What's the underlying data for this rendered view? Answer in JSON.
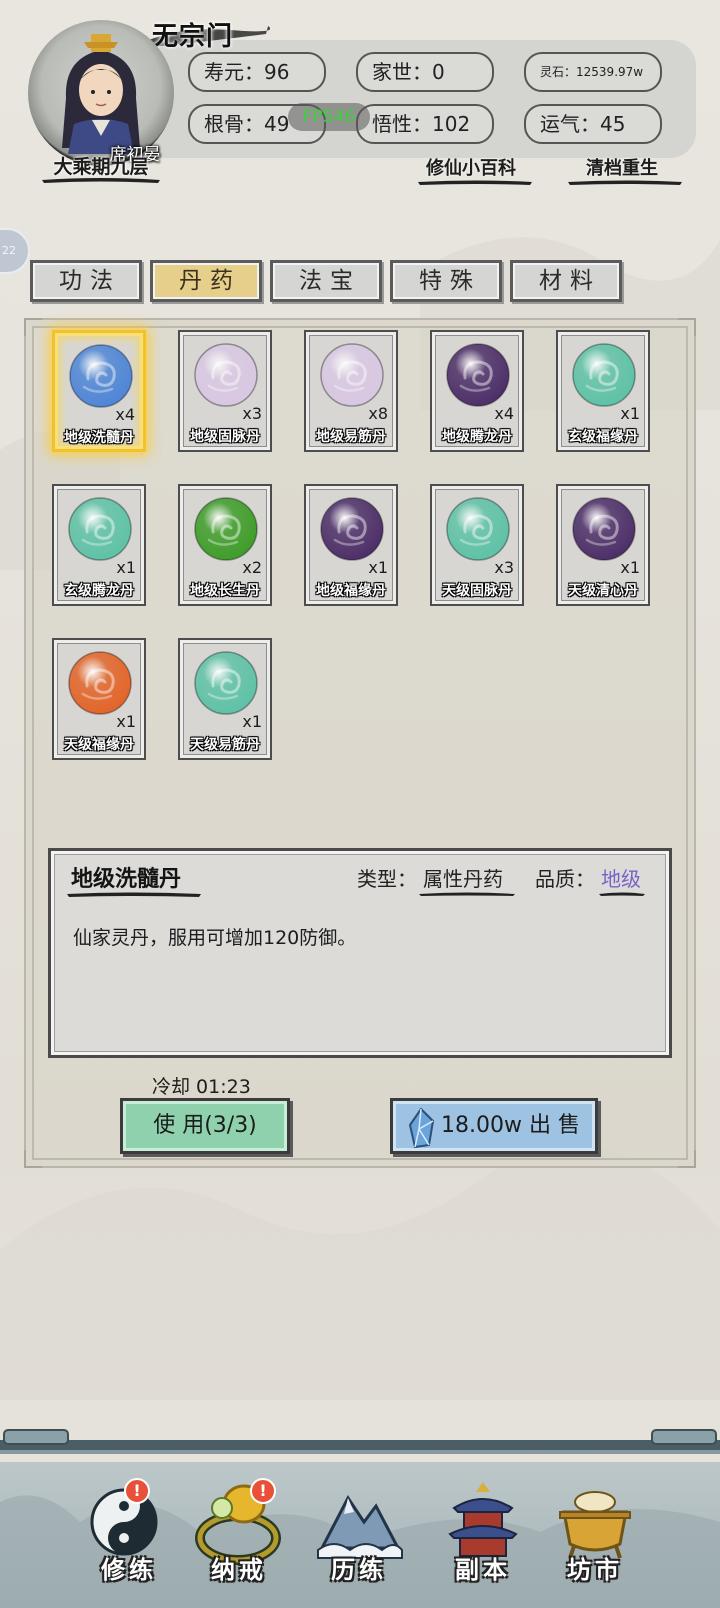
{
  "header": {
    "sect_name": "无宗门",
    "player_name": "席初晏",
    "realm": "大乘期九层",
    "fps": "FPS46",
    "stats": [
      {
        "label": "寿元：",
        "value": "96"
      },
      {
        "label": "家世：",
        "value": "0"
      },
      {
        "label": "灵石：",
        "value": "12539.97w"
      },
      {
        "label": "根骨：",
        "value": "49"
      },
      {
        "label": "悟性：",
        "value": "102"
      },
      {
        "label": "运气：",
        "value": "45"
      }
    ],
    "links": {
      "wiki": "修仙小百科",
      "reset": "清档重生"
    },
    "side_tab": "22"
  },
  "tabs": [
    {
      "label": "功法",
      "active": false
    },
    {
      "label": "丹药",
      "active": true
    },
    {
      "label": "法宝",
      "active": false
    },
    {
      "label": "特殊",
      "active": false
    },
    {
      "label": "材料",
      "active": false
    }
  ],
  "items": [
    {
      "name": "地级洗髓丹",
      "qty": "x4",
      "color": "#4f86d6",
      "selected": true
    },
    {
      "name": "地级固脉丹",
      "qty": "x3",
      "color": "#d8c8e2",
      "selected": false
    },
    {
      "name": "地级易筋丹",
      "qty": "x8",
      "color": "#d8c8e2",
      "selected": false
    },
    {
      "name": "地级腾龙丹",
      "qty": "x4",
      "color": "#4d2f68",
      "selected": false
    },
    {
      "name": "玄级福缘丹",
      "qty": "x1",
      "color": "#5fc2a6",
      "selected": false
    },
    {
      "name": "玄级腾龙丹",
      "qty": "x1",
      "color": "#5fc2a6",
      "selected": false
    },
    {
      "name": "地级长生丹",
      "qty": "x2",
      "color": "#3f9d2a",
      "selected": false
    },
    {
      "name": "地级福缘丹",
      "qty": "x1",
      "color": "#4d2f68",
      "selected": false
    },
    {
      "name": "天级固脉丹",
      "qty": "x3",
      "color": "#5fc2a6",
      "selected": false
    },
    {
      "name": "天级清心丹",
      "qty": "x1",
      "color": "#4d2f68",
      "selected": false
    },
    {
      "name": "天级福缘丹",
      "qty": "x1",
      "color": "#e2652a",
      "selected": false
    },
    {
      "name": "天级易筋丹",
      "qty": "x1",
      "color": "#5fc2a6",
      "selected": false
    }
  ],
  "detail": {
    "title": "地级洗髓丹",
    "type_label": "类型：",
    "type_value": "属性丹药",
    "quality_label": "品质：",
    "quality_value": "地级",
    "quality_color": "#7a62c9",
    "description": "仙家灵丹，服用可增加120防御。"
  },
  "actions": {
    "cooldown": "冷却 01:23",
    "use_label": "使 用(3/3)",
    "sell_label": "18.00w 出 售"
  },
  "nav": [
    {
      "label": "修练",
      "icon": "taiji-icon",
      "alert": true
    },
    {
      "label": "纳戒",
      "icon": "ring-icon",
      "alert": true
    },
    {
      "label": "历练",
      "icon": "mountain-icon",
      "alert": false
    },
    {
      "label": "副本",
      "icon": "pagoda-icon",
      "alert": false
    },
    {
      "label": "坊市",
      "icon": "cauldron-icon",
      "alert": false
    }
  ]
}
